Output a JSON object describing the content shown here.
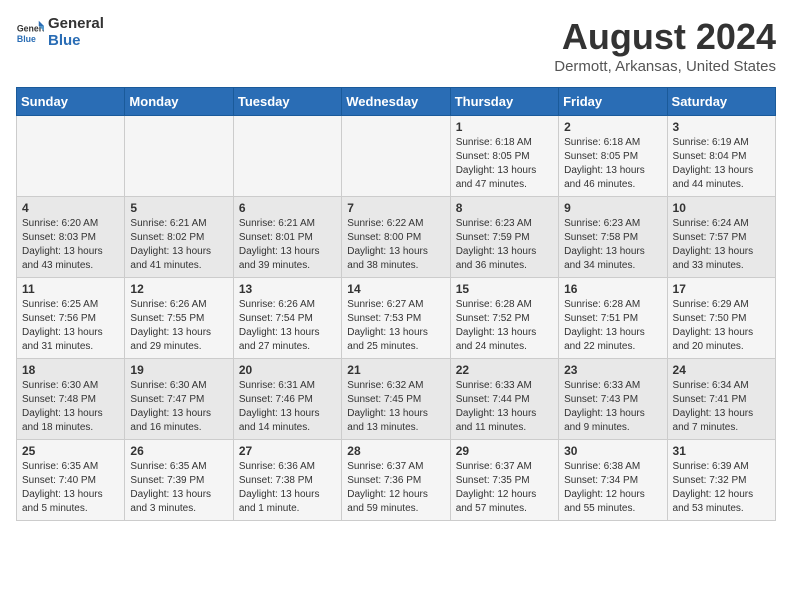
{
  "header": {
    "logo_general": "General",
    "logo_blue": "Blue",
    "main_title": "August 2024",
    "subtitle": "Dermott, Arkansas, United States"
  },
  "days_of_week": [
    "Sunday",
    "Monday",
    "Tuesday",
    "Wednesday",
    "Thursday",
    "Friday",
    "Saturday"
  ],
  "weeks": [
    [
      {
        "day": "",
        "info": ""
      },
      {
        "day": "",
        "info": ""
      },
      {
        "day": "",
        "info": ""
      },
      {
        "day": "",
        "info": ""
      },
      {
        "day": "1",
        "info": "Sunrise: 6:18 AM\nSunset: 8:05 PM\nDaylight: 13 hours\nand 47 minutes."
      },
      {
        "day": "2",
        "info": "Sunrise: 6:18 AM\nSunset: 8:05 PM\nDaylight: 13 hours\nand 46 minutes."
      },
      {
        "day": "3",
        "info": "Sunrise: 6:19 AM\nSunset: 8:04 PM\nDaylight: 13 hours\nand 44 minutes."
      }
    ],
    [
      {
        "day": "4",
        "info": "Sunrise: 6:20 AM\nSunset: 8:03 PM\nDaylight: 13 hours\nand 43 minutes."
      },
      {
        "day": "5",
        "info": "Sunrise: 6:21 AM\nSunset: 8:02 PM\nDaylight: 13 hours\nand 41 minutes."
      },
      {
        "day": "6",
        "info": "Sunrise: 6:21 AM\nSunset: 8:01 PM\nDaylight: 13 hours\nand 39 minutes."
      },
      {
        "day": "7",
        "info": "Sunrise: 6:22 AM\nSunset: 8:00 PM\nDaylight: 13 hours\nand 38 minutes."
      },
      {
        "day": "8",
        "info": "Sunrise: 6:23 AM\nSunset: 7:59 PM\nDaylight: 13 hours\nand 36 minutes."
      },
      {
        "day": "9",
        "info": "Sunrise: 6:23 AM\nSunset: 7:58 PM\nDaylight: 13 hours\nand 34 minutes."
      },
      {
        "day": "10",
        "info": "Sunrise: 6:24 AM\nSunset: 7:57 PM\nDaylight: 13 hours\nand 33 minutes."
      }
    ],
    [
      {
        "day": "11",
        "info": "Sunrise: 6:25 AM\nSunset: 7:56 PM\nDaylight: 13 hours\nand 31 minutes."
      },
      {
        "day": "12",
        "info": "Sunrise: 6:26 AM\nSunset: 7:55 PM\nDaylight: 13 hours\nand 29 minutes."
      },
      {
        "day": "13",
        "info": "Sunrise: 6:26 AM\nSunset: 7:54 PM\nDaylight: 13 hours\nand 27 minutes."
      },
      {
        "day": "14",
        "info": "Sunrise: 6:27 AM\nSunset: 7:53 PM\nDaylight: 13 hours\nand 25 minutes."
      },
      {
        "day": "15",
        "info": "Sunrise: 6:28 AM\nSunset: 7:52 PM\nDaylight: 13 hours\nand 24 minutes."
      },
      {
        "day": "16",
        "info": "Sunrise: 6:28 AM\nSunset: 7:51 PM\nDaylight: 13 hours\nand 22 minutes."
      },
      {
        "day": "17",
        "info": "Sunrise: 6:29 AM\nSunset: 7:50 PM\nDaylight: 13 hours\nand 20 minutes."
      }
    ],
    [
      {
        "day": "18",
        "info": "Sunrise: 6:30 AM\nSunset: 7:48 PM\nDaylight: 13 hours\nand 18 minutes."
      },
      {
        "day": "19",
        "info": "Sunrise: 6:30 AM\nSunset: 7:47 PM\nDaylight: 13 hours\nand 16 minutes."
      },
      {
        "day": "20",
        "info": "Sunrise: 6:31 AM\nSunset: 7:46 PM\nDaylight: 13 hours\nand 14 minutes."
      },
      {
        "day": "21",
        "info": "Sunrise: 6:32 AM\nSunset: 7:45 PM\nDaylight: 13 hours\nand 13 minutes."
      },
      {
        "day": "22",
        "info": "Sunrise: 6:33 AM\nSunset: 7:44 PM\nDaylight: 13 hours\nand 11 minutes."
      },
      {
        "day": "23",
        "info": "Sunrise: 6:33 AM\nSunset: 7:43 PM\nDaylight: 13 hours\nand 9 minutes."
      },
      {
        "day": "24",
        "info": "Sunrise: 6:34 AM\nSunset: 7:41 PM\nDaylight: 13 hours\nand 7 minutes."
      }
    ],
    [
      {
        "day": "25",
        "info": "Sunrise: 6:35 AM\nSunset: 7:40 PM\nDaylight: 13 hours\nand 5 minutes."
      },
      {
        "day": "26",
        "info": "Sunrise: 6:35 AM\nSunset: 7:39 PM\nDaylight: 13 hours\nand 3 minutes."
      },
      {
        "day": "27",
        "info": "Sunrise: 6:36 AM\nSunset: 7:38 PM\nDaylight: 13 hours\nand 1 minute."
      },
      {
        "day": "28",
        "info": "Sunrise: 6:37 AM\nSunset: 7:36 PM\nDaylight: 12 hours\nand 59 minutes."
      },
      {
        "day": "29",
        "info": "Sunrise: 6:37 AM\nSunset: 7:35 PM\nDaylight: 12 hours\nand 57 minutes."
      },
      {
        "day": "30",
        "info": "Sunrise: 6:38 AM\nSunset: 7:34 PM\nDaylight: 12 hours\nand 55 minutes."
      },
      {
        "day": "31",
        "info": "Sunrise: 6:39 AM\nSunset: 7:32 PM\nDaylight: 12 hours\nand 53 minutes."
      }
    ]
  ]
}
